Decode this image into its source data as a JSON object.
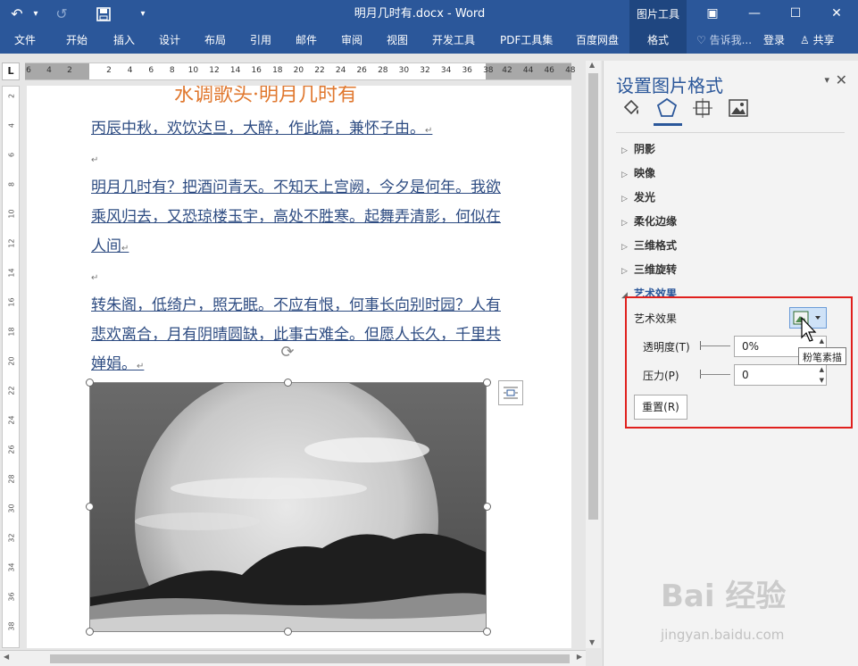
{
  "titlebar": {
    "undo_icon": "↶",
    "undo_menu": "▾",
    "redo_icon": "↺",
    "save_icon": "save",
    "customize_icon": "▾",
    "doc_title": "明月几时有.docx - Word",
    "context_tab_title": "图片工具",
    "window_buttons": [
      "▣",
      "—",
      "☐",
      "✕"
    ]
  },
  "ribbon": {
    "tabs": [
      "文件",
      "开始",
      "插入",
      "设计",
      "布局",
      "引用",
      "邮件",
      "审阅",
      "视图",
      "开发工具",
      "PDF工具集",
      "百度网盘",
      "格式"
    ],
    "active_tab": "格式",
    "tell_me": "告诉我...",
    "sign_in": "登录",
    "share": "共享"
  },
  "ruler": {
    "corner": "L",
    "h_numbers": [
      "6",
      "4",
      "2",
      "2",
      "4",
      "6",
      "8",
      "10",
      "12",
      "14",
      "16",
      "18",
      "20",
      "22",
      "24",
      "26",
      "28",
      "30",
      "32",
      "34",
      "36",
      "38",
      "42",
      "44",
      "46",
      "48"
    ],
    "v_numbers": [
      "2",
      "4",
      "6",
      "8",
      "10",
      "12",
      "14",
      "16",
      "18",
      "20",
      "22",
      "24",
      "26",
      "28",
      "30",
      "32",
      "34",
      "36",
      "38"
    ]
  },
  "document": {
    "heading": "水调歌头·明月几时有",
    "preface": "丙辰中秋，欢饮达旦，大醉，作此篇，兼怀子由。",
    "para1": "明月几时有？把酒问青天。不知天上宫阙，今夕是何年。我欲乘风归去，又恐琼楼玉宇，高处不胜寒。起舞弄清影，何似在人间",
    "para2": "转朱阁，低绮户，照无眠。不应有恨，何事长向别时园？人有悲欢离合，月有阴晴圆缺，此事古难全。但愿人长久，千里共婵娟。",
    "paragraph_mark": "↵"
  },
  "pane": {
    "title": "设置图片格式",
    "menu_icon": "▾",
    "close_icon": "✕",
    "tabs": [
      "fill-line-icon",
      "effects-icon",
      "layout-size-icon",
      "picture-icon"
    ],
    "sections": [
      "阴影",
      "映像",
      "发光",
      "柔化边缘",
      "三维格式",
      "三维旋转",
      "艺术效果"
    ],
    "collapsed_arrow": "▷",
    "expanded_arrow": "◢",
    "art_effects": {
      "label": "艺术效果",
      "transparency_label": "透明度(T)",
      "transparency_value": "0%",
      "pressure_label": "压力(P)",
      "pressure_value": "0",
      "reset_label": "重置(R)",
      "tooltip": "粉笔素描"
    }
  },
  "watermark": {
    "text": "Bai 经验",
    "url": "jingyan.baidu.com"
  },
  "colors": {
    "ribbon": "#2b579a",
    "text_blue": "#2e4c82",
    "heading_orange": "#e0782f",
    "highlight_red": "#e0201d"
  }
}
